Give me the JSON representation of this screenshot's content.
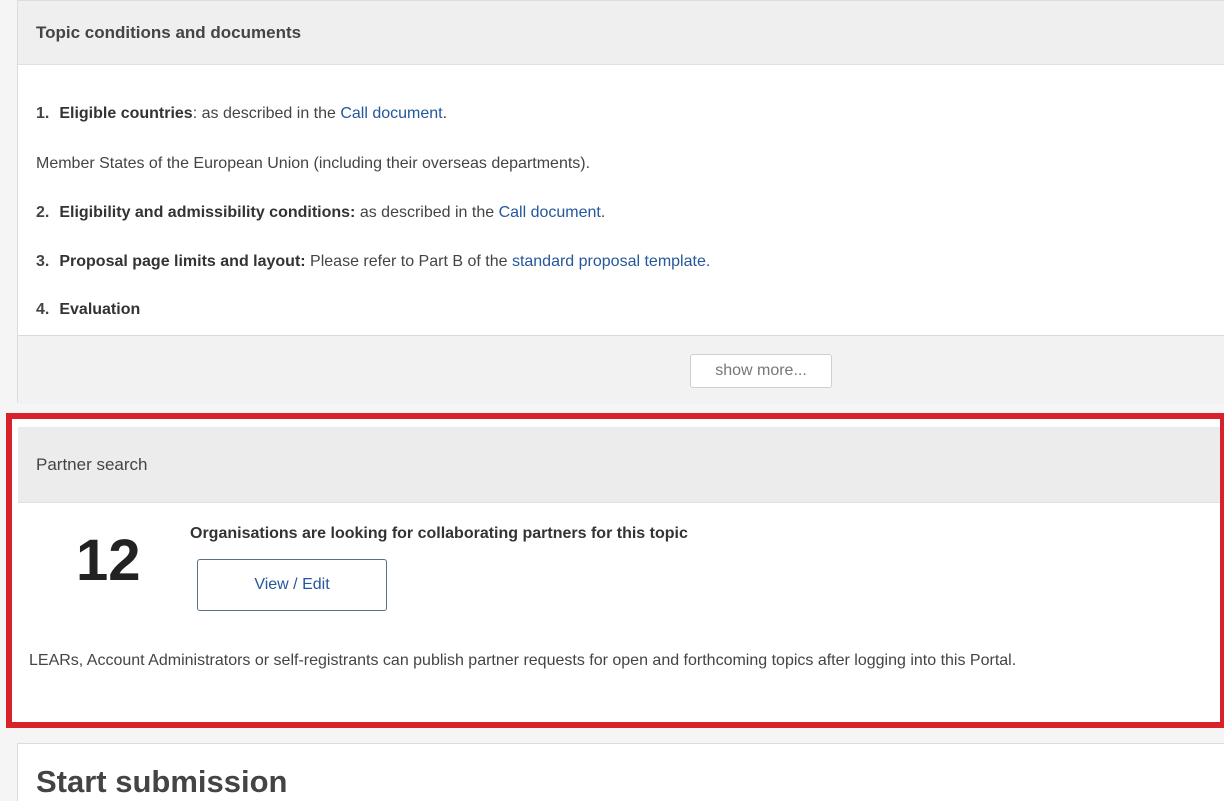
{
  "conditions_panel": {
    "title": "Topic conditions and documents",
    "items": [
      {
        "num": "1.",
        "label": "Eligible countries",
        "text": ": as described in the ",
        "link": "Call document",
        "after": "."
      },
      {
        "plain": "Member States of the European Union (including their overseas departments)."
      },
      {
        "num": "2.",
        "label": "Eligibility and admissibility conditions:",
        "text": " as described in the ",
        "link": "Call document",
        "after": "."
      },
      {
        "num": "3.",
        "label": "Proposal page limits and layout:",
        "text": " Please refer to Part B of the ",
        "link": "standard proposal template",
        "after": "."
      },
      {
        "num": "4.",
        "label": "Evaluation"
      }
    ],
    "show_more_label": "show more..."
  },
  "partner_panel": {
    "title": "Partner search",
    "count": "12",
    "description": "Organisations are looking for collaborating partners for this topic",
    "button_label": "View / Edit",
    "note": "LEARs, Account Administrators or self-registrants can publish partner requests for open and forthcoming topics after logging into this Portal.",
    "highlight_color": "#d7222b"
  },
  "submission_panel": {
    "title": "Start submission"
  }
}
